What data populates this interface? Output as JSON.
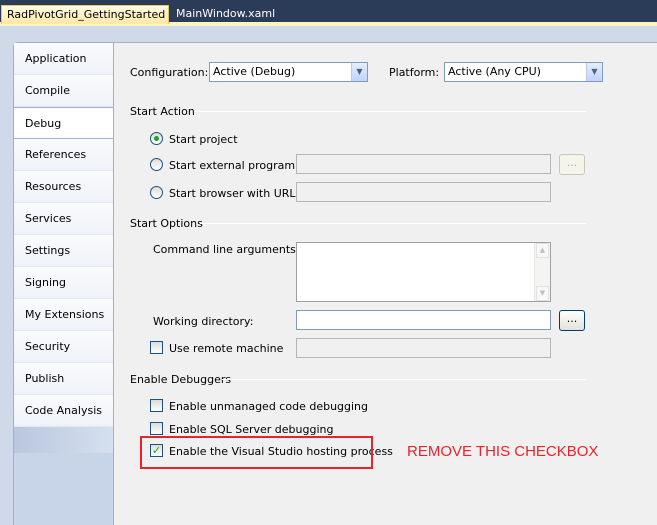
{
  "doc_tabs": [
    {
      "label": "RadPivotGrid_GettingStarted",
      "active": true
    },
    {
      "label": "MainWindow.xaml",
      "active": false
    }
  ],
  "nav": {
    "items": [
      {
        "label": "Application"
      },
      {
        "label": "Compile"
      },
      {
        "label": "Debug",
        "selected": true
      },
      {
        "label": "References"
      },
      {
        "label": "Resources"
      },
      {
        "label": "Services"
      },
      {
        "label": "Settings"
      },
      {
        "label": "Signing"
      },
      {
        "label": "My Extensions"
      },
      {
        "label": "Security"
      },
      {
        "label": "Publish"
      },
      {
        "label": "Code Analysis"
      }
    ]
  },
  "config": {
    "configuration_label": "Configuration:",
    "configuration_value": "Active (Debug)",
    "platform_label": "Platform:",
    "platform_value": "Active (Any CPU)"
  },
  "start_action": {
    "heading": "Start Action",
    "start_project": "Start project",
    "start_external": "Start external program:",
    "start_browser": "Start browser with URL:",
    "browse_label": "..."
  },
  "start_options": {
    "heading": "Start Options",
    "cmd_args_label": "Command line arguments:",
    "working_dir_label": "Working directory:",
    "working_dir_button": "...",
    "remote_machine_label": "Use remote machine"
  },
  "debuggers": {
    "heading": "Enable Debuggers",
    "unmanaged": {
      "label": "Enable unmanaged code debugging",
      "checked": false
    },
    "sql": {
      "label": "Enable SQL Server debugging",
      "checked": false
    },
    "hosting": {
      "label": "Enable the Visual Studio hosting process",
      "checked": true
    }
  },
  "annotation": {
    "text": "REMOVE THIS CHECKBOX",
    "color": "#e8232a"
  },
  "colors": {
    "accent_green": "#21a121",
    "window_bg": "#2b3c59",
    "panel_bg": "#f0f0f0"
  }
}
